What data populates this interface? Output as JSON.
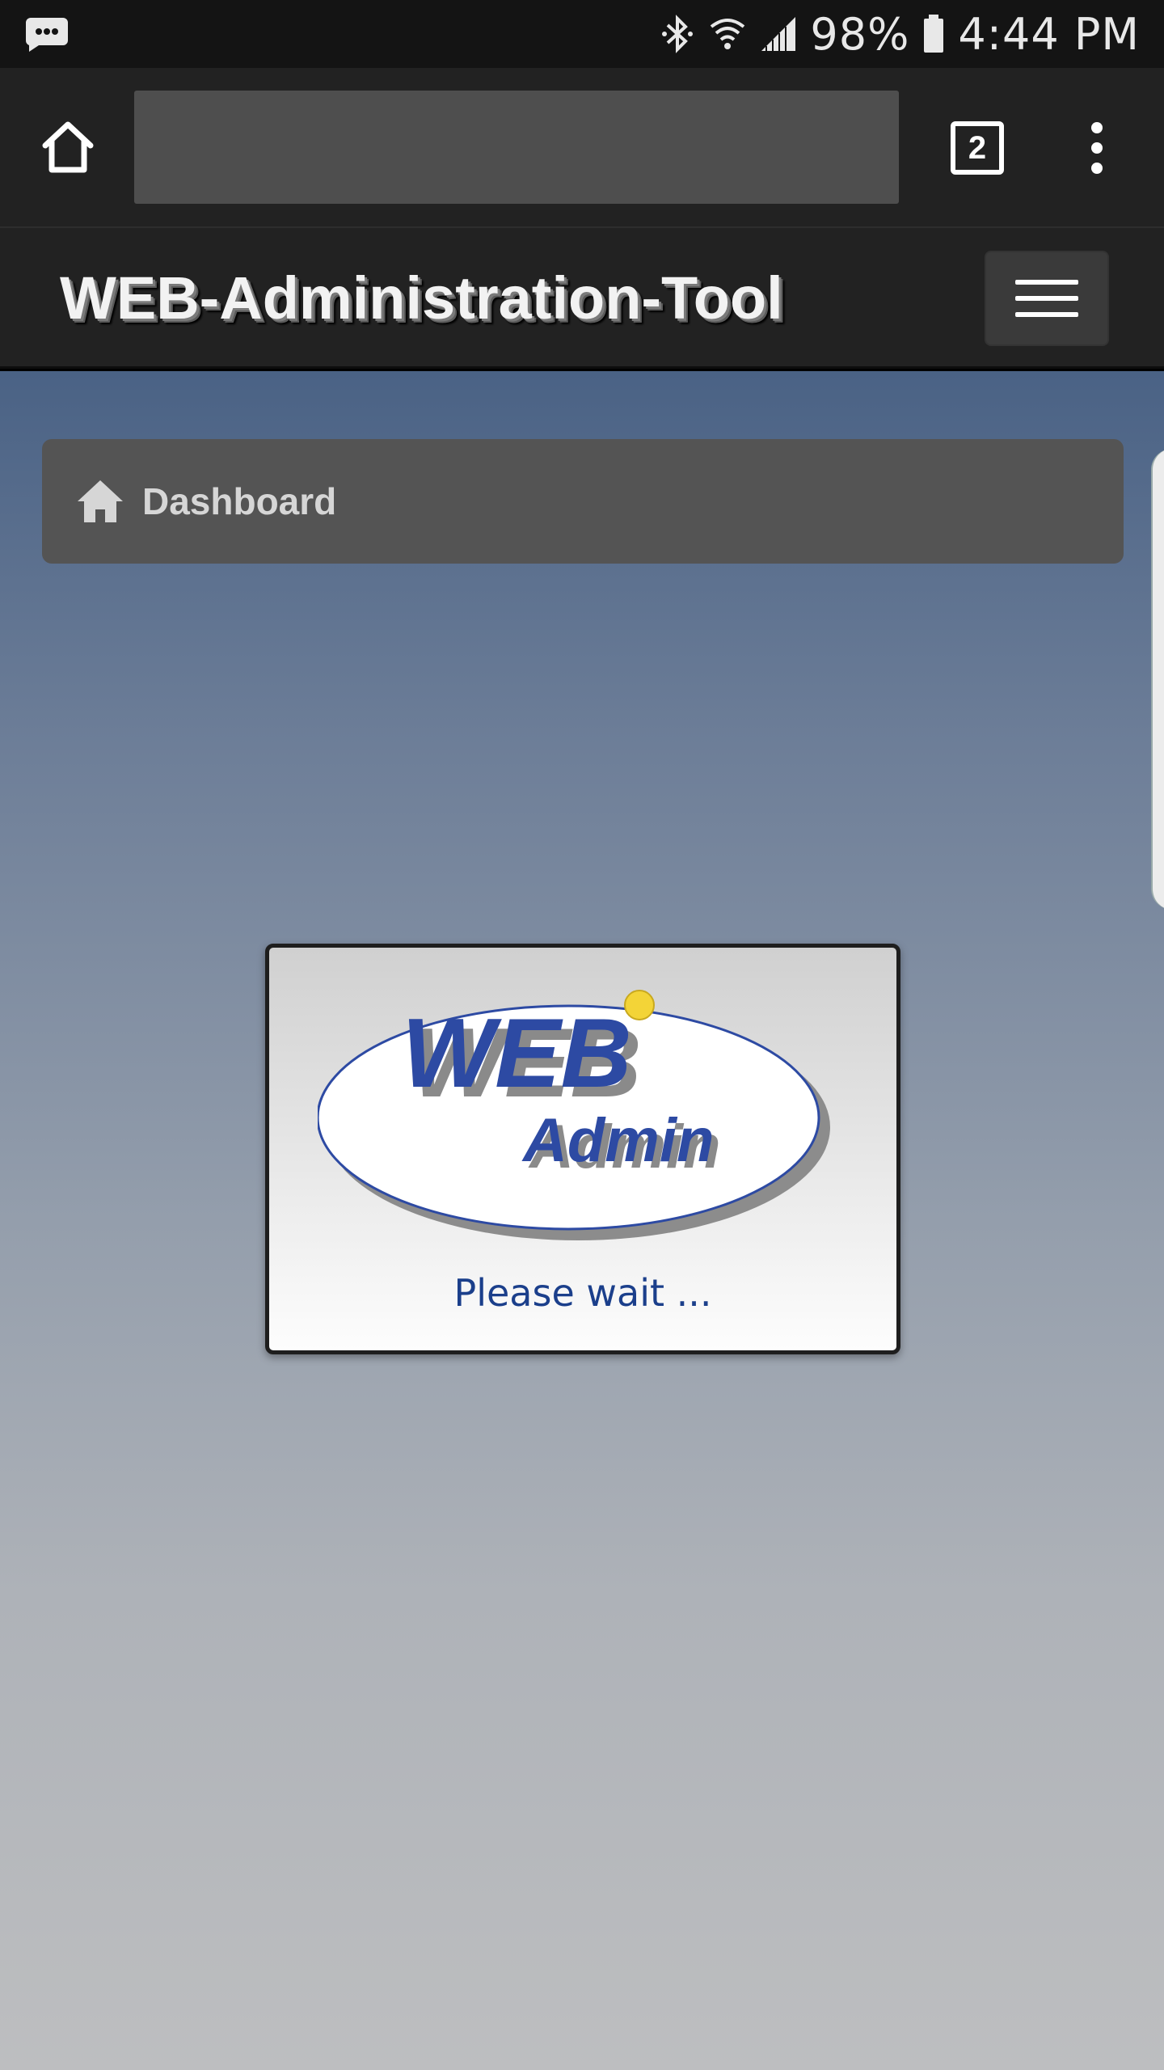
{
  "status_bar": {
    "notification_icon": "chat-bubble-icon",
    "bluetooth_icon": "bluetooth-icon",
    "wifi_icon": "wifi-icon",
    "signal_icon": "cell-signal-icon",
    "battery_percent": "98%",
    "battery_icon": "battery-icon",
    "time": "4:44 PM"
  },
  "browser": {
    "home_icon": "home-outline-icon",
    "url": "",
    "tab_count": "2",
    "menu_icon": "more-vertical-icon"
  },
  "header": {
    "title": "WEB-Administration-Tool",
    "menu_icon": "hamburger-icon"
  },
  "breadcrumb": {
    "icon": "home-icon",
    "label": "Dashboard"
  },
  "loading_modal": {
    "logo_line1": "WEB",
    "logo_line2": "Admin",
    "message": "Please wait ..."
  },
  "colors": {
    "status_bar_bg": "#141414",
    "toolbar_bg": "#222222",
    "url_bar_bg": "#4e4e4e",
    "breadcrumb_bg": "#545454",
    "logo_blue": "#2d4aa3",
    "wait_text": "#1b3f8b",
    "logo_dot": "#f3d437"
  }
}
